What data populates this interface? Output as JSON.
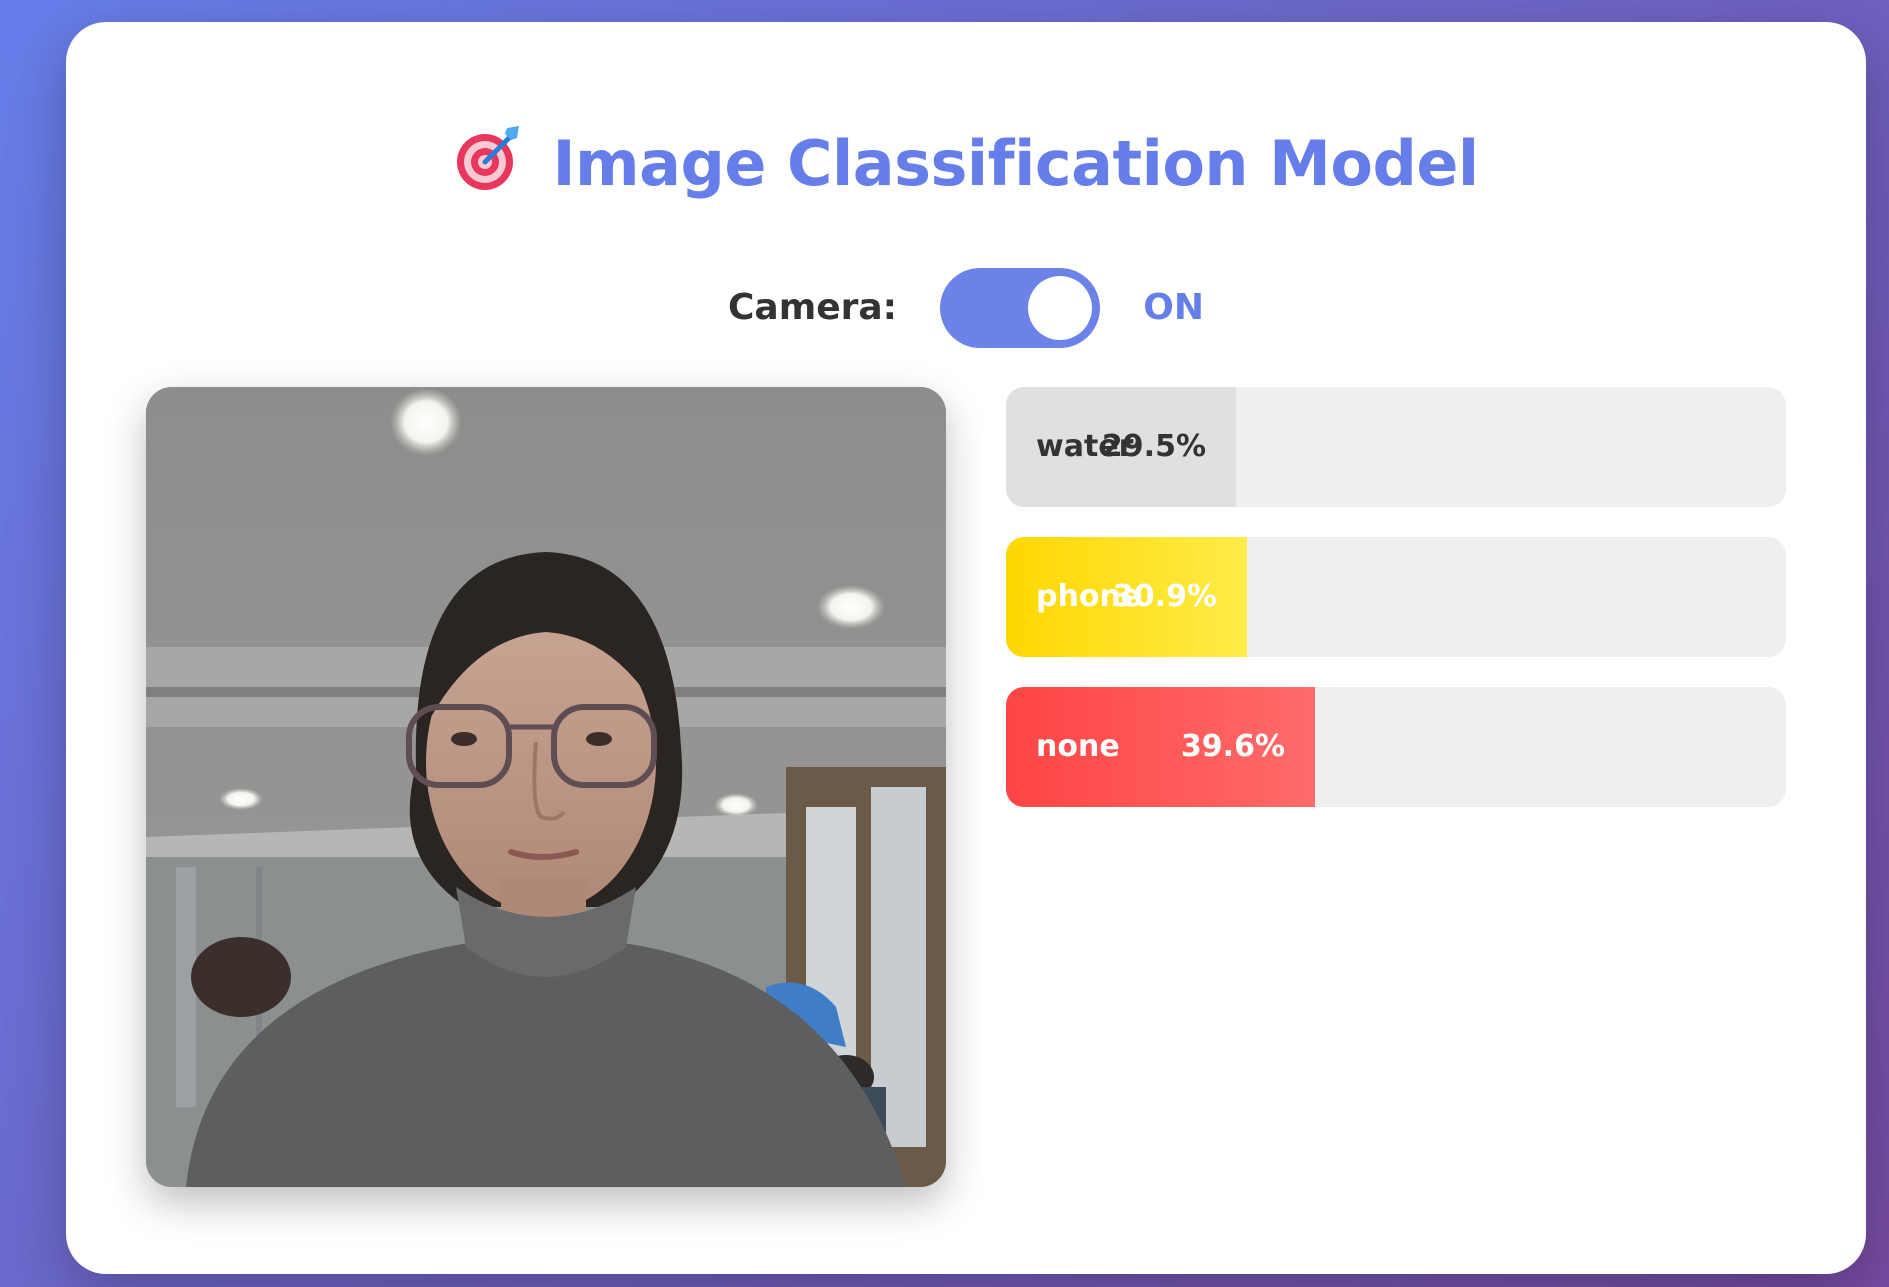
{
  "header": {
    "icon": "target-dart-icon",
    "title": "Image Classification Model"
  },
  "camera": {
    "label": "Camera:",
    "state": "ON",
    "enabled": true,
    "toggle_color": "#6b82e8"
  },
  "video": {
    "icon": "webcam-feed-image"
  },
  "predictions": [
    {
      "label": "water",
      "percent_text": "29.5%",
      "value": 0.295,
      "colors": [
        "#e0e0e0",
        "#e0e0e0"
      ],
      "text_color": "#333333"
    },
    {
      "label": "phone",
      "percent_text": "30.9%",
      "value": 0.309,
      "colors": [
        "#ffd700",
        "#ffec4a"
      ],
      "text_color": "#ffffff"
    },
    {
      "label": "none",
      "percent_text": "39.6%",
      "value": 0.396,
      "colors": [
        "#ff4444",
        "#ff6b6b"
      ],
      "text_color": "#ffffff"
    }
  ],
  "theme": {
    "accent": "#667eea",
    "bg_from": "#667eea",
    "bg_to": "#764ba2"
  }
}
